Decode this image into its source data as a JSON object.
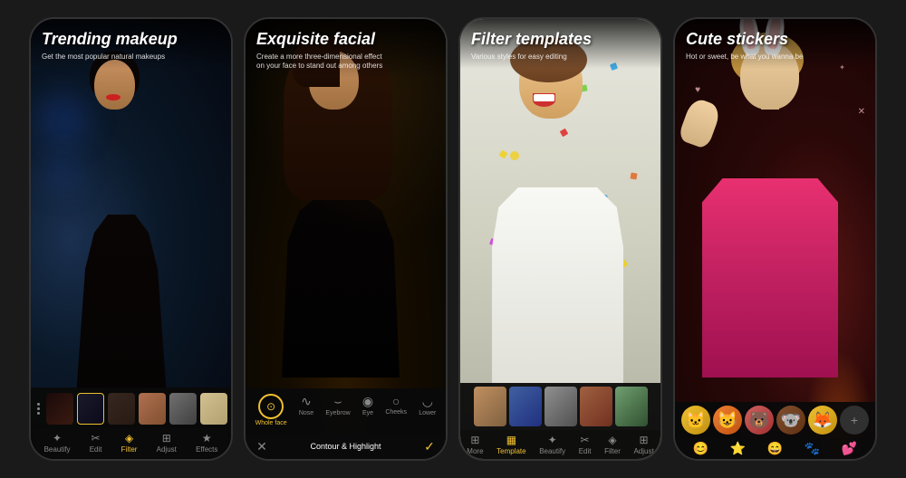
{
  "phones": [
    {
      "id": "phone-1",
      "title": "Trending makeup",
      "subtitle": "Get the most popular natural makeups",
      "nav_tabs": [
        {
          "label": "Beautify",
          "active": false
        },
        {
          "label": "Edit",
          "active": false
        },
        {
          "label": "Filter",
          "active": true
        },
        {
          "label": "Adjust",
          "active": false
        },
        {
          "label": "Effects",
          "active": false
        }
      ],
      "more_label": "More"
    },
    {
      "id": "phone-2",
      "title": "Exquisite facial",
      "subtitle": "Create a more three-dimensional effect\non your face to stand out among others",
      "facial_tools": [
        {
          "label": "Whole face",
          "active": true
        },
        {
          "label": "Nose",
          "active": false
        },
        {
          "label": "Eyebrow",
          "active": false
        },
        {
          "label": "Eye",
          "active": false
        },
        {
          "label": "Cheeks",
          "active": false
        },
        {
          "label": "Lower",
          "active": false
        }
      ],
      "bottom_label": "Contour & Highlight"
    },
    {
      "id": "phone-3",
      "title": "Filter templates",
      "subtitle": "Various styles for easy editing",
      "nav_tabs": [
        {
          "label": "More",
          "active": false
        },
        {
          "label": "Template",
          "active": true
        },
        {
          "label": "Beautify",
          "active": false
        },
        {
          "label": "Edit",
          "active": false
        },
        {
          "label": "Filter",
          "active": false
        },
        {
          "label": "Adjust",
          "active": false
        }
      ]
    },
    {
      "id": "phone-4",
      "title": "Cute stickers",
      "subtitle": "Hot or sweet, be what you wanna be"
    }
  ],
  "colors": {
    "gold": "#f0c030",
    "dark_bg": "#111111",
    "text_white": "#ffffff",
    "text_gray": "#888888",
    "active_gold": "#f0c030"
  }
}
